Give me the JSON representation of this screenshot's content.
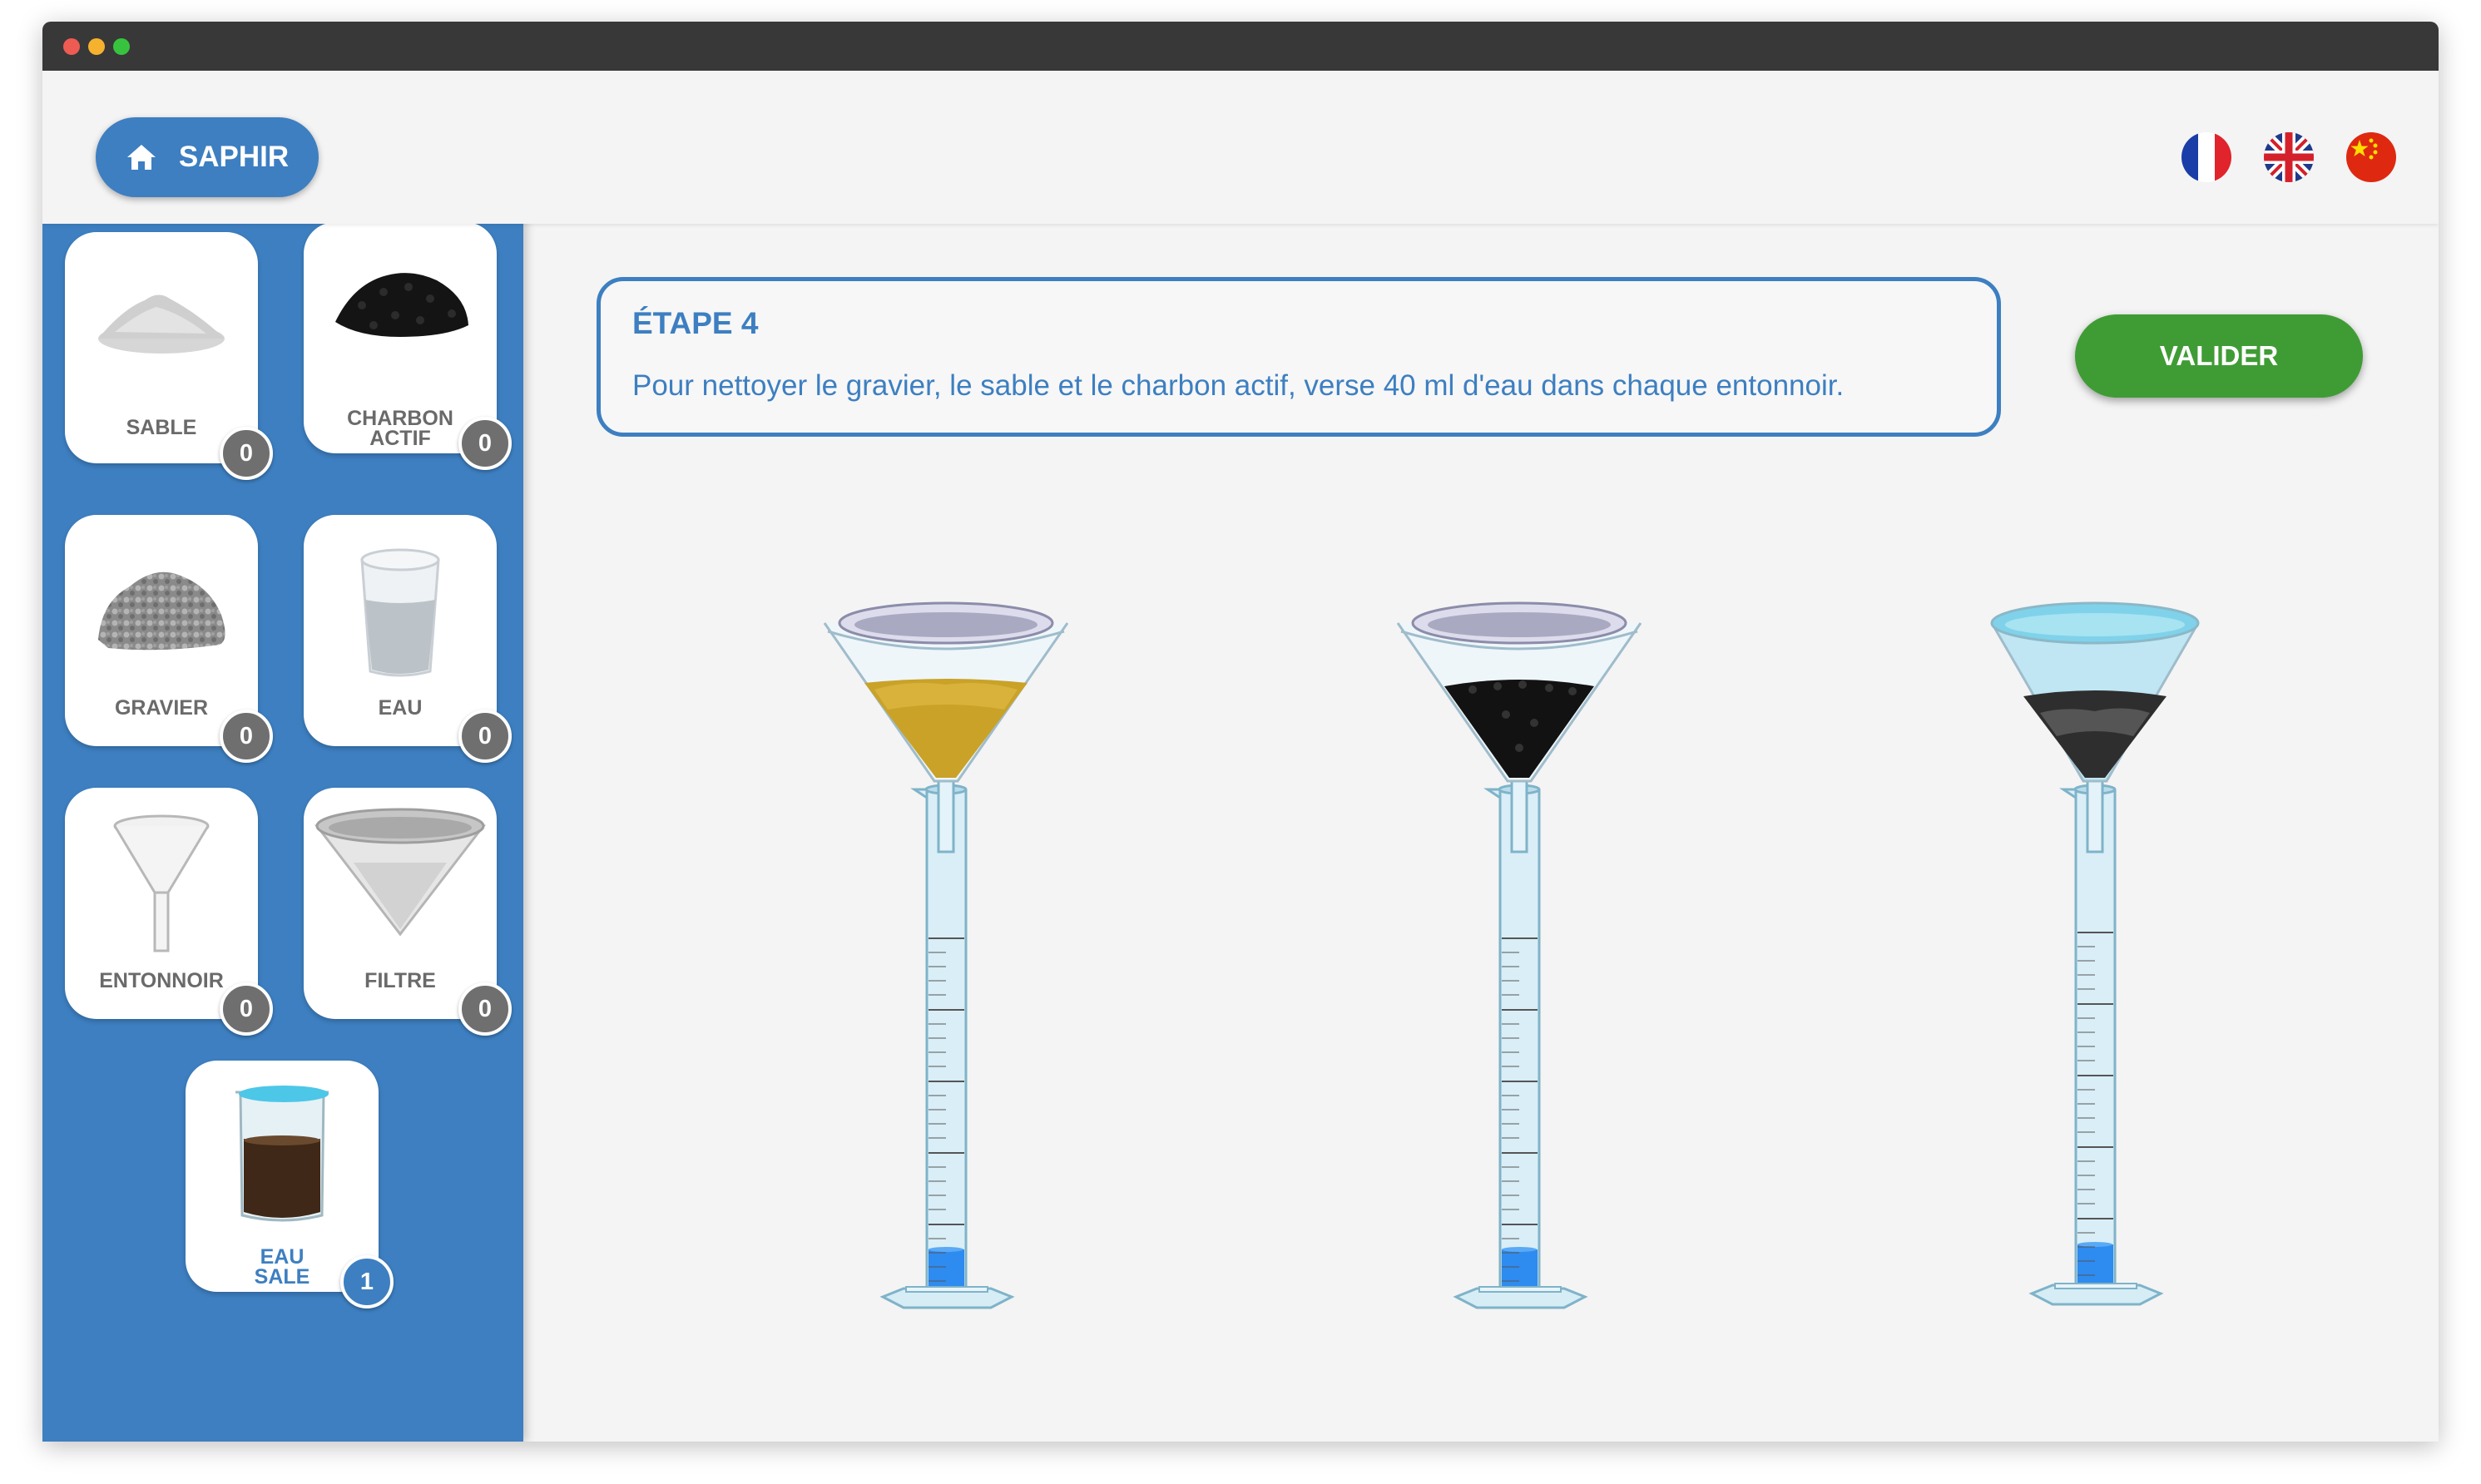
{
  "window": {
    "controls": [
      {
        "name": "close",
        "color": "#ee5b52"
      },
      {
        "name": "minimize",
        "color": "#f6b22e"
      },
      {
        "name": "maximize",
        "color": "#38c33f"
      }
    ]
  },
  "header": {
    "home_label": "SAPHIR",
    "home_icon": "home-icon",
    "languages": [
      {
        "code": "fr",
        "icon": "flag-france-icon"
      },
      {
        "code": "en",
        "icon": "flag-uk-icon"
      },
      {
        "code": "zh",
        "icon": "flag-china-icon"
      }
    ]
  },
  "sidebar": {
    "items": [
      {
        "label": "SABLE",
        "count": "0",
        "icon": "sand-icon"
      },
      {
        "label_line1": "CHARBON",
        "label_line2": "ACTIF",
        "count": "0",
        "icon": "activated-charcoal-icon"
      },
      {
        "label": "GRAVIER",
        "count": "0",
        "icon": "gravel-icon"
      },
      {
        "label": "EAU",
        "count": "0",
        "icon": "water-glass-icon"
      },
      {
        "label": "ENTONNOIR",
        "count": "0",
        "icon": "funnel-icon"
      },
      {
        "label": "FILTRE",
        "count": "0",
        "icon": "filter-icon"
      },
      {
        "label_line1": "EAU",
        "label_line2": "SALE",
        "count": "1",
        "icon": "dirty-water-beaker-icon"
      }
    ]
  },
  "instruction": {
    "step": "ÉTAPE 4",
    "text": "Pour nettoyer le gravier, le sable et le charbon actif, verse 40 ml d'eau dans chaque entonnoir."
  },
  "actions": {
    "validate_label": "VALIDER"
  },
  "colors": {
    "primary": "#3d7fc1",
    "validate": "#3f9c35",
    "badge": "#6f6f6f",
    "liquid": "#3b8ee8"
  },
  "apparatus": [
    {
      "funnel_content": "sand",
      "icon": "graduated-cylinder-icon"
    },
    {
      "funnel_content": "activated-charcoal",
      "icon": "graduated-cylinder-icon"
    },
    {
      "funnel_content": "gravel",
      "icon": "graduated-cylinder-icon"
    }
  ]
}
